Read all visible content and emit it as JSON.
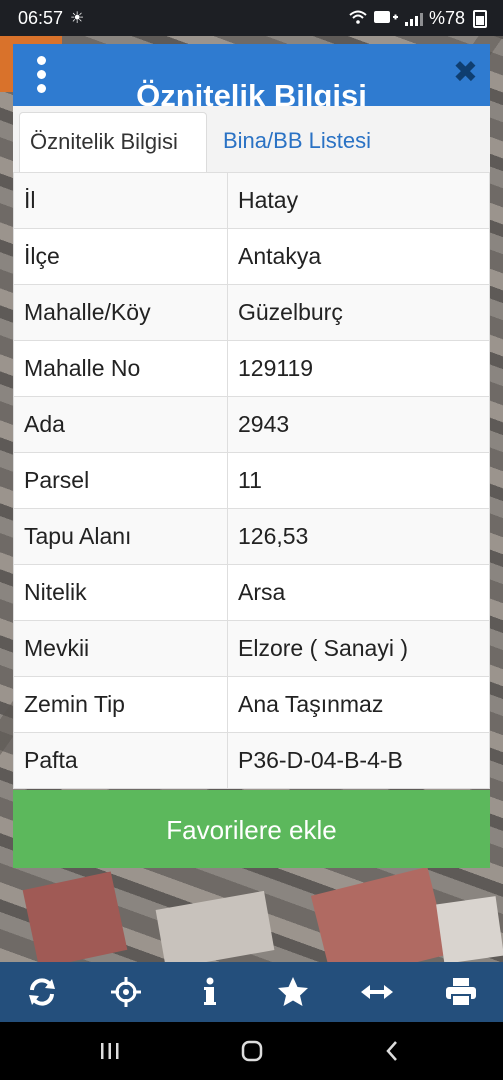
{
  "status_bar": {
    "time": "06:57",
    "battery": "%78"
  },
  "dialog": {
    "title": "Öznitelik Bilgisi",
    "tabs": [
      {
        "label": "Öznitelik Bilgisi",
        "active": true
      },
      {
        "label": "Bina/BB Listesi",
        "active": false
      }
    ],
    "rows": [
      {
        "key": "İl",
        "value": "Hatay"
      },
      {
        "key": "İlçe",
        "value": "Antakya"
      },
      {
        "key": "Mahalle/Köy",
        "value": "Güzelburç"
      },
      {
        "key": "Mahalle No",
        "value": "129119"
      },
      {
        "key": "Ada",
        "value": "2943"
      },
      {
        "key": "Parsel",
        "value": "11"
      },
      {
        "key": "Tapu Alanı",
        "value": "126,53"
      },
      {
        "key": "Nitelik",
        "value": "Arsa"
      },
      {
        "key": "Mevkii",
        "value": "Elzore ( Sanayi )"
      },
      {
        "key": "Zemin Tip",
        "value": "Ana Taşınmaz"
      },
      {
        "key": "Pafta",
        "value": "P36-D-04-B-4-B"
      }
    ],
    "favorite_button": "Favorilere ekle"
  },
  "toolbar": {
    "icons": [
      "refresh-icon",
      "crosshair-icon",
      "info-icon",
      "star-icon",
      "measure-icon",
      "print-icon"
    ]
  },
  "colors": {
    "header": "#2f7bd0",
    "toolbar": "#244f7c",
    "favorite_button": "#5cb85c",
    "tab_link": "#2a72c4"
  }
}
